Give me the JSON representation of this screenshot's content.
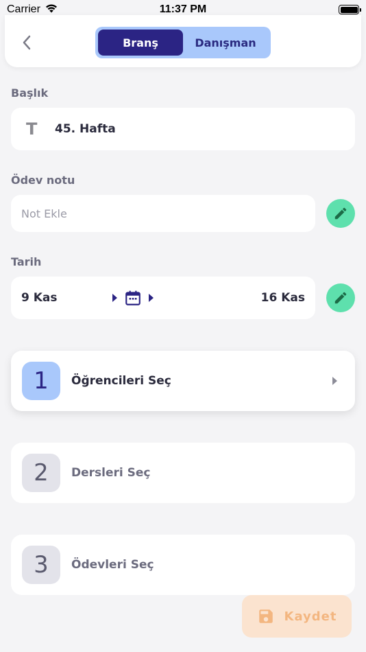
{
  "status_bar": {
    "carrier": "Carrier",
    "time": "11:37 PM",
    "wifi_icon": "wifi-icon",
    "battery_icon": "battery-icon"
  },
  "header": {
    "back_icon": "chevron-left-icon",
    "tabs": [
      {
        "label": "Branş",
        "active": true
      },
      {
        "label": "Danışman",
        "active": false
      }
    ]
  },
  "title_section": {
    "label": "Başlık",
    "icon": "text-t-icon",
    "icon_glyph": "T",
    "value": "45. Hafta"
  },
  "note_section": {
    "label": "Ödev notu",
    "placeholder": "Not Ekle",
    "value": "",
    "edit_icon": "pencil-icon"
  },
  "date_section": {
    "label": "Tarih",
    "start": "9 Kas",
    "end": "16 Kas",
    "calendar_icon": "calendar-icon",
    "edit_icon": "pencil-icon"
  },
  "steps": [
    {
      "number": "1",
      "label": "Öğrencileri Seç",
      "active": true
    },
    {
      "number": "2",
      "label": "Dersleri Seç",
      "active": false
    },
    {
      "number": "3",
      "label": "Ödevleri Seç",
      "active": false
    }
  ],
  "save_button": {
    "label": "Kaydet",
    "icon": "floppy-disk-icon"
  },
  "colors": {
    "accent_dark": "#2b2484",
    "accent_light": "#a9c8fb",
    "edit_green": "#5ee0ad",
    "save_bg": "#fbe3cf",
    "save_fg": "#f3b680"
  }
}
